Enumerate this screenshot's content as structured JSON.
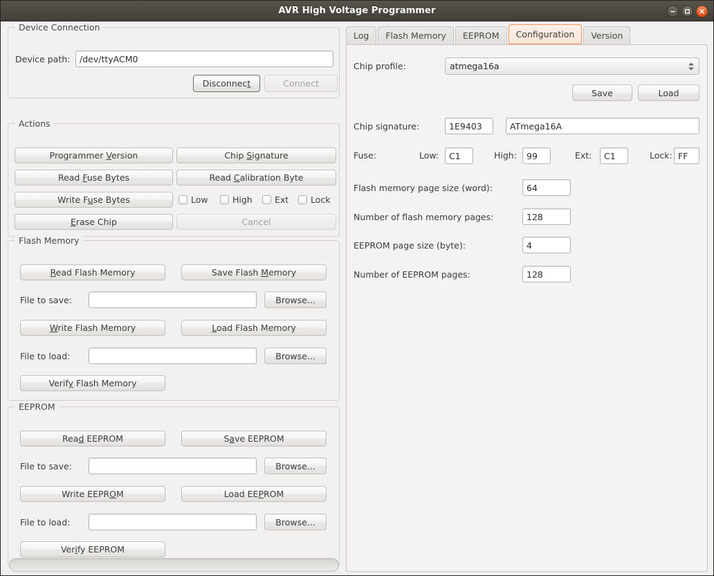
{
  "window": {
    "title": "AVR High Voltage Programmer",
    "controls": [
      {
        "name": "minimize-button",
        "glyph": "minimize"
      },
      {
        "name": "maximize-button",
        "glyph": "maximize"
      },
      {
        "name": "close-button",
        "glyph": "close"
      }
    ]
  },
  "device_connection": {
    "group_title": "Device Connection",
    "device_path_label": "Device path:",
    "device_path_value": "/dev/ttyACM0",
    "disconnect_label": "Disconnect",
    "disconnect_mnemonic": "t",
    "connect_label": "Connect",
    "connect_enabled": false
  },
  "actions": {
    "group_title": "Actions",
    "programmer_version": {
      "pre": "Programmer ",
      "mn": "V",
      "post": "ersion"
    },
    "chip_signature": {
      "pre": "Chip ",
      "mn": "S",
      "post": "ignature"
    },
    "read_fuse_bytes": {
      "pre": "Read ",
      "mn": "F",
      "post": "use Bytes"
    },
    "read_calibration_byte": {
      "pre": "Read ",
      "mn": "C",
      "post": "alibration Byte"
    },
    "write_fuse_bytes": {
      "pre": "Write F",
      "mn": "u",
      "post": "se Bytes"
    },
    "erase_chip": {
      "pre": "",
      "mn": "E",
      "post": "rase Chip"
    },
    "cancel_label": "Cancel",
    "cancel_enabled": false,
    "fuse_checkboxes": [
      {
        "label": "Low",
        "checked": false
      },
      {
        "label": "High",
        "checked": false
      },
      {
        "label": "Ext",
        "checked": false
      },
      {
        "label": "Lock",
        "checked": false
      }
    ]
  },
  "flash_memory": {
    "group_title": "Flash Memory",
    "read": {
      "pre": "",
      "mn": "R",
      "post": "ead Flash Memory"
    },
    "save": {
      "pre": "Save Flash ",
      "mn": "M",
      "post": "emory"
    },
    "write": {
      "pre": "",
      "mn": "W",
      "post": "rite Flash Memory"
    },
    "load": {
      "pre": "",
      "mn": "L",
      "post": "oad Flash Memory"
    },
    "verify": {
      "pre": "Verif",
      "mn": "y",
      "post": " Flash Memory"
    },
    "file_to_save_label": "File to save:",
    "file_to_save_value": "",
    "file_to_load_label": "File to load:",
    "file_to_load_value": "",
    "browse_label": "Browse..."
  },
  "eeprom": {
    "group_title": "EEPROM",
    "read": {
      "pre": "Rea",
      "mn": "d",
      "post": " EEPROM"
    },
    "save": {
      "pre": "S",
      "mn": "a",
      "post": "ve EEPROM"
    },
    "write": {
      "pre": "Write EEPR",
      "mn": "O",
      "post": "M"
    },
    "load": {
      "pre": "Load EE",
      "mn": "P",
      "post": "ROM"
    },
    "verify": {
      "pre": "Ver",
      "mn": "i",
      "post": "fy EEPROM"
    },
    "file_to_save_label": "File to save:",
    "file_to_save_value": "",
    "file_to_load_label": "File to load:",
    "file_to_load_value": "",
    "browse_label": "Browse..."
  },
  "progress": {
    "value": 0,
    "name": "operation-progress-bar"
  },
  "tabs": {
    "items": [
      {
        "label": "Log",
        "selected": false
      },
      {
        "label": "Flash Memory",
        "selected": false
      },
      {
        "label": "EEPROM",
        "selected": false
      },
      {
        "label": "Configuration",
        "selected": true
      },
      {
        "label": "Version",
        "selected": false
      }
    ],
    "selected_index": 3,
    "selected_color": "#f0955a"
  },
  "configuration": {
    "chip_profile_label": "Chip profile:",
    "chip_profile_value": "atmega16a",
    "save_label": "Save",
    "load_label": "Load",
    "chip_signature_label": "Chip signature:",
    "chip_signature_hex": "1E9403",
    "chip_signature_name": "ATmega16A",
    "fuse_label": "Fuse:",
    "fuse_low_label": "Low:",
    "fuse_low_value": "C1",
    "fuse_high_label": "High:",
    "fuse_high_value": "99",
    "fuse_ext_label": "Ext:",
    "fuse_ext_value": "C1",
    "fuse_lock_label": "Lock:",
    "fuse_lock_value": "FF",
    "flash_page_size_label": "Flash memory page size (word):",
    "flash_page_size_value": "64",
    "flash_page_count_label": "Number of flash memory pages:",
    "flash_page_count_value": "128",
    "eeprom_page_size_label": "EEPROM page size (byte):",
    "eeprom_page_size_value": "4",
    "eeprom_page_count_label": "Number of EEPROM pages:",
    "eeprom_page_count_value": "128"
  }
}
